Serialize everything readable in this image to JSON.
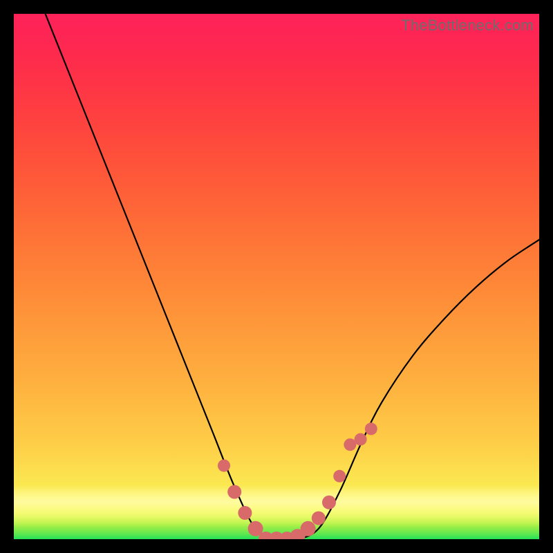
{
  "watermark": "TheBottleneck.com",
  "chart_data": {
    "type": "line",
    "title": "",
    "xlabel": "",
    "ylabel": "",
    "xlim": [
      0,
      100
    ],
    "ylim": [
      0,
      100
    ],
    "background_gradient": {
      "direction": "vertical",
      "stops": [
        {
          "pos": 0,
          "color": "#ff235a"
        },
        {
          "pos": 50,
          "color": "#fec946"
        },
        {
          "pos": 94,
          "color": "#f9f74b"
        },
        {
          "pos": 100,
          "color": "#24e158"
        }
      ]
    },
    "series": [
      {
        "name": "curve",
        "x": [
          6,
          10,
          14,
          18,
          22,
          26,
          30,
          34,
          38,
          42,
          46,
          50,
          54,
          58,
          62,
          66,
          70,
          76,
          82,
          88,
          94,
          100
        ],
        "y": [
          100,
          90,
          80,
          70,
          60,
          50,
          40,
          30,
          20,
          10,
          2,
          0,
          0,
          2,
          9,
          18,
          26,
          35,
          42,
          48,
          53,
          57
        ]
      }
    ],
    "markers": {
      "name": "beads",
      "color": "#d96a6a",
      "x": [
        40,
        42,
        44,
        46,
        48,
        50,
        52,
        54,
        56,
        58,
        60,
        62,
        64,
        66,
        68
      ],
      "y": [
        14,
        9,
        5,
        2,
        0,
        0,
        0,
        0.5,
        2,
        4,
        7,
        12,
        18,
        19,
        21
      ]
    }
  }
}
